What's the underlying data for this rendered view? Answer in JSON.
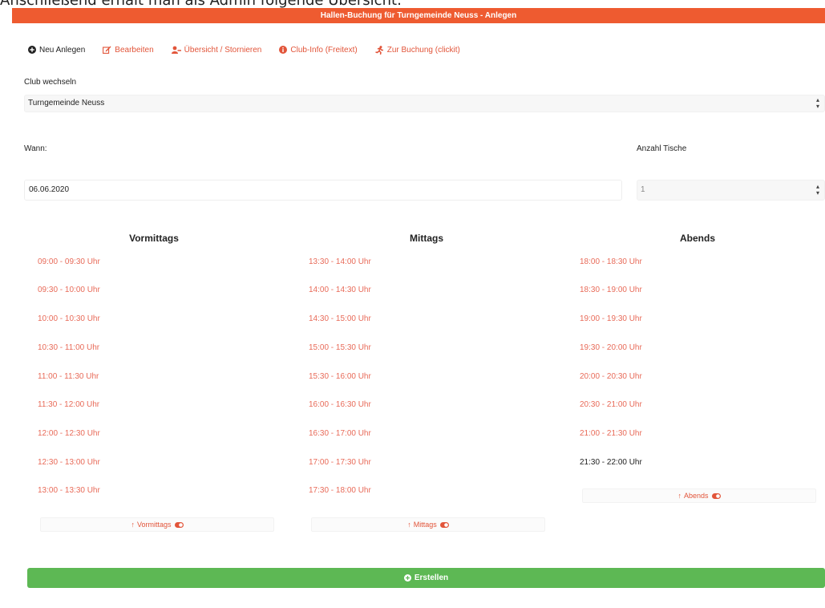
{
  "doc_heading": "Anschließend erhält man als Admin folgende Übersicht:",
  "app": {
    "title": "Hallen-Buchung für Turngemeinde Neuss - Anlegen",
    "brand_color": "#ee5b30",
    "success_color": "#5db854"
  },
  "tabs": [
    {
      "label": "Neu Anlegen",
      "icon": "plus-circle-icon",
      "active": true
    },
    {
      "label": "Bearbeiten",
      "icon": "edit-icon",
      "active": false
    },
    {
      "label": "Übersicht / Stornieren",
      "icon": "user-minus-icon",
      "active": false
    },
    {
      "label": "Club-Info (Freitext)",
      "icon": "info-icon",
      "active": false
    },
    {
      "label": "Zur Buchung (clickit)",
      "icon": "running-icon",
      "active": false
    }
  ],
  "club": {
    "label": "Club wechseln",
    "value": "Turngemeinde Neuss"
  },
  "when": {
    "label": "Wann:",
    "value": "06.06.2020"
  },
  "tables": {
    "label": "Anzahl Tische",
    "value": "1"
  },
  "columns": {
    "morning": {
      "title": "Vormittags",
      "slots": [
        {
          "text": "09:00 - 09:30 Uhr",
          "booked": false
        },
        {
          "text": "09:30 - 10:00 Uhr",
          "booked": false
        },
        {
          "text": "10:00 - 10:30 Uhr",
          "booked": false
        },
        {
          "text": "10:30 - 11:00 Uhr",
          "booked": false
        },
        {
          "text": "11:00 - 11:30 Uhr",
          "booked": false
        },
        {
          "text": "11:30 - 12:00 Uhr",
          "booked": false
        },
        {
          "text": "12:00 - 12:30 Uhr",
          "booked": false
        },
        {
          "text": "12:30 - 13:00 Uhr",
          "booked": false
        },
        {
          "text": "13:00 - 13:30 Uhr",
          "booked": false
        }
      ],
      "toggle_label": "Vormittags"
    },
    "noon": {
      "title": "Mittags",
      "slots": [
        {
          "text": "13:30 - 14:00 Uhr",
          "booked": false
        },
        {
          "text": "14:00 - 14:30 Uhr",
          "booked": false
        },
        {
          "text": "14:30 - 15:00 Uhr",
          "booked": false
        },
        {
          "text": "15:00 - 15:30 Uhr",
          "booked": false
        },
        {
          "text": "15:30 - 16:00 Uhr",
          "booked": false
        },
        {
          "text": "16:00 - 16:30 Uhr",
          "booked": false
        },
        {
          "text": "16:30 - 17:00 Uhr",
          "booked": false
        },
        {
          "text": "17:00 - 17:30 Uhr",
          "booked": false
        },
        {
          "text": "17:30 - 18:00 Uhr",
          "booked": false
        }
      ],
      "toggle_label": "Mittags"
    },
    "evening": {
      "title": "Abends",
      "slots": [
        {
          "text": "18:00 - 18:30 Uhr",
          "booked": false
        },
        {
          "text": "18:30 - 19:00 Uhr",
          "booked": false
        },
        {
          "text": "19:00 - 19:30 Uhr",
          "booked": false
        },
        {
          "text": "19:30 - 20:00 Uhr",
          "booked": false
        },
        {
          "text": "20:00 - 20:30 Uhr",
          "booked": false
        },
        {
          "text": "20:30 - 21:00 Uhr",
          "booked": false
        },
        {
          "text": "21:00 - 21:30 Uhr",
          "booked": false
        },
        {
          "text": "21:30 - 22:00 Uhr",
          "booked": true
        }
      ],
      "toggle_label": "Abends"
    }
  },
  "create_label": "Erstellen"
}
